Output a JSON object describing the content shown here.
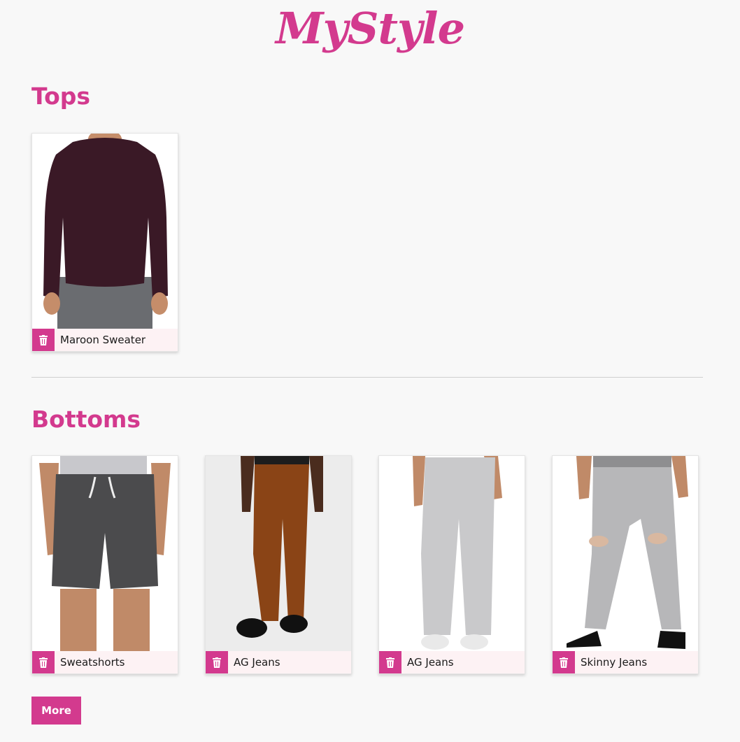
{
  "app": {
    "logo_text": "MyStyle",
    "accent_color": "#d33a8e"
  },
  "tops": {
    "title": "Tops",
    "items": [
      {
        "name": "Maroon Sweater",
        "icon": "trash-icon"
      }
    ]
  },
  "bottoms": {
    "title": "Bottoms",
    "items": [
      {
        "name": "Sweatshorts",
        "icon": "trash-icon"
      },
      {
        "name": "AG Jeans",
        "icon": "trash-icon"
      },
      {
        "name": "AG Jeans",
        "icon": "trash-icon"
      },
      {
        "name": "Skinny Jeans",
        "icon": "trash-icon"
      }
    ]
  },
  "actions": {
    "more_label": "More"
  }
}
